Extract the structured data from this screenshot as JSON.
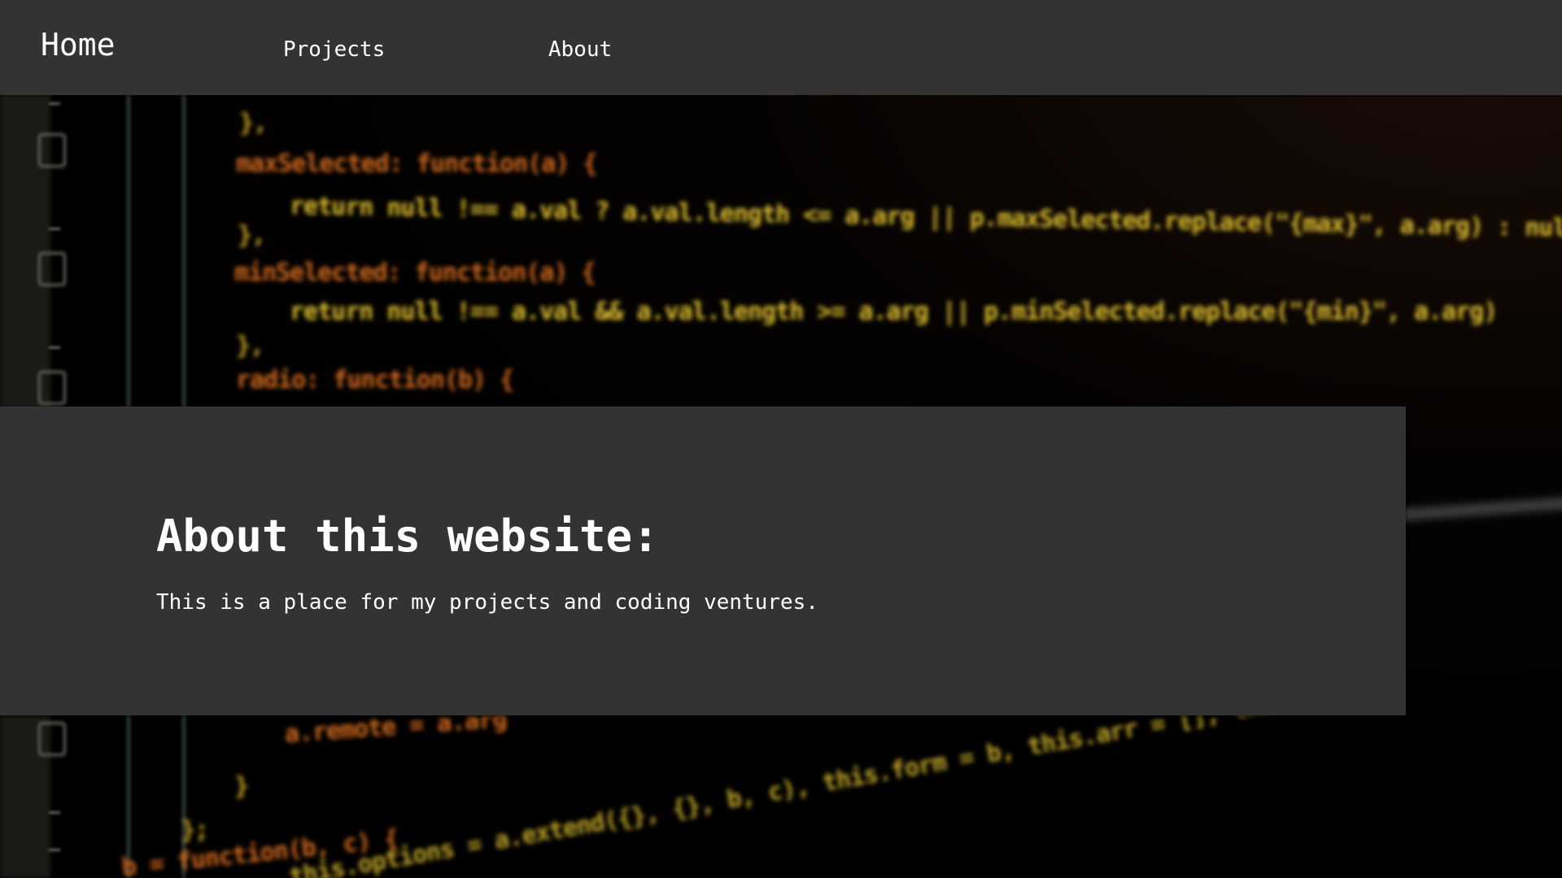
{
  "nav": {
    "home_label": "Home",
    "projects_label": "Projects",
    "about_label": "About"
  },
  "about": {
    "heading": "About this website:",
    "body": "This is a place for my projects and coding ventures."
  },
  "background": {
    "description_icon": "blurred-code-editor-background",
    "code_lines": [
      "},",
      "maxSelected: function(a) {",
      "return null !== a.val ? a.val.length <= a.arg || p.maxSelected.replace(\"{max}\", a.arg) : null;",
      "},",
      "minSelected: function(a) {",
      "return null !== a.val && a.val.length >= a.arg || p.minSelected.replace(\"{min}\", a.arg)",
      "},",
      "radio: function(b) {",
      "a.remote = a.arg",
      "}",
      "};",
      "b = function(b, c) {",
      "this.options = a.extend({}, {}, b, c), this.form = b, this.arr = [], this.remote"
    ]
  },
  "colors": {
    "bar_background": "#333333",
    "text": "#ffffff",
    "code_orange": "#d2691e",
    "code_yellow": "#c9a227"
  }
}
